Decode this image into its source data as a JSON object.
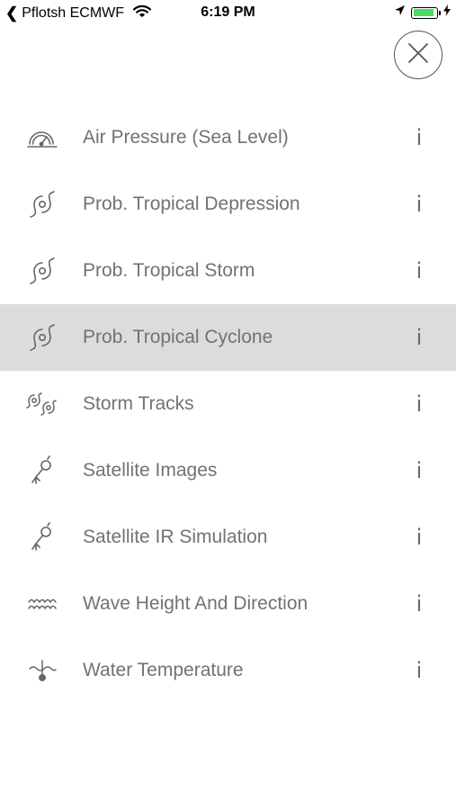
{
  "status_bar": {
    "back_symbol": "❮",
    "carrier": "Pflotsh ECMWF",
    "time": "6:19 PM",
    "battery_color": "#4cd964"
  },
  "close_button": {
    "icon": "close-icon"
  },
  "menu": {
    "items": [
      {
        "label": "Air Pressure (Sea Level)",
        "icon": "gauge-icon",
        "info": "i",
        "selected": false
      },
      {
        "label": "Prob. Tropical Depression",
        "icon": "cyclone-icon",
        "info": "i",
        "selected": false
      },
      {
        "label": "Prob. Tropical Storm",
        "icon": "cyclone-icon",
        "info": "i",
        "selected": false
      },
      {
        "label": "Prob. Tropical Cyclone",
        "icon": "cyclone-icon",
        "info": "i",
        "selected": true
      },
      {
        "label": "Storm Tracks",
        "icon": "storm-tracks-icon",
        "info": "i",
        "selected": false
      },
      {
        "label": "Satellite Images",
        "icon": "satellite-icon",
        "info": "i",
        "selected": false
      },
      {
        "label": "Satellite IR Simulation",
        "icon": "satellite-icon",
        "info": "i",
        "selected": false
      },
      {
        "label": "Wave Height And Direction",
        "icon": "waves-icon",
        "info": "i",
        "selected": false
      },
      {
        "label": "Water Temperature",
        "icon": "water-temperature-icon",
        "info": "i",
        "selected": false
      }
    ],
    "selected_color": "#dcdcdc"
  }
}
